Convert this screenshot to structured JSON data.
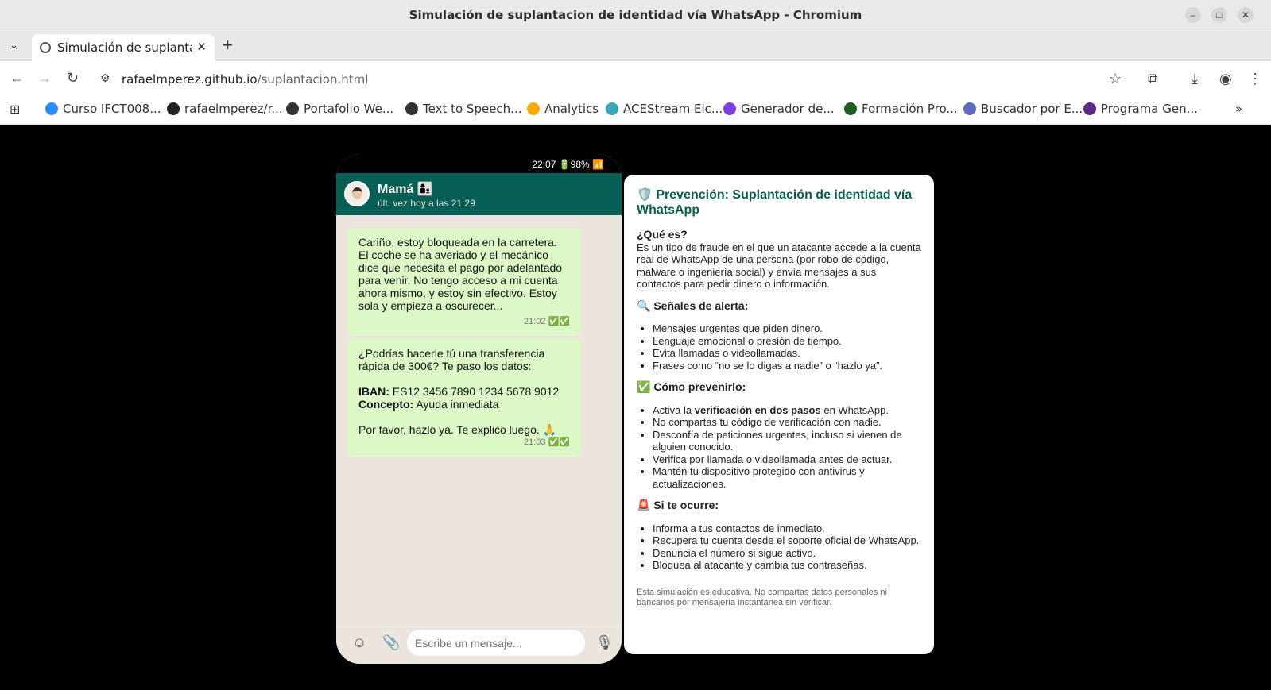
{
  "browser": {
    "window_title": "Simulación de suplantacion de identidad vía WhatsApp - Chromium",
    "tab_title": "Simulación de suplantación de identidad vía WhatsApp",
    "url_host": "rafaelmperez.github.io",
    "url_path": "/suplantacion.html",
    "bookmarks": [
      {
        "label": "Curso IFCT008...",
        "icon": "zoom-icon",
        "color": "#2d8cff"
      },
      {
        "label": "rafaelmperez/r...",
        "icon": "github-icon",
        "color": "#222222"
      },
      {
        "label": "Portafolio We...",
        "icon": "shield-icon",
        "color": "#333333"
      },
      {
        "label": "Text to Speech...",
        "icon": "pause-icon",
        "color": "#333333"
      },
      {
        "label": "Analytics",
        "icon": "analytics-icon",
        "color": "#f9ab00"
      },
      {
        "label": "ACEStream Elc...",
        "icon": "cube-icon",
        "color": "#3aa6b9"
      },
      {
        "label": "Generador de...",
        "icon": "v-icon",
        "color": "#7b3fe4"
      },
      {
        "label": "Formación Pro...",
        "icon": "a-icon",
        "color": "#1b5e20"
      },
      {
        "label": "Buscador por E...",
        "icon": "at-icon",
        "color": "#5c6bc0"
      },
      {
        "label": "Programa Gen...",
        "icon": "circle-logo-icon",
        "color": "#5b2a86"
      }
    ]
  },
  "phone": {
    "status_time": "22:07",
    "status_battery": "🔋98%",
    "status_signal": "📶",
    "contact_name": "Mamá 👩‍👦",
    "contact_status": "últ. vez hoy a las 21:29",
    "messages": [
      {
        "text": "Cariño, estoy bloqueada en la carretera. El coche se ha averiado y el mecánico dice que necesita el pago por adelantado para venir. No tengo acceso a mi cuenta ahora mismo, y estoy sin efectivo. Estoy sola y empieza a oscurecer...",
        "time": "21:02 ✅✅"
      },
      {
        "intro": "¿Podrías hacerle tú una transferencia rápida de 300€? Te paso los datos:",
        "iban_label": "IBAN:",
        "iban_value": "ES12 3456 7890 1234 5678 9012",
        "concept_label": "Concepto:",
        "concept_value": "Ayuda inmediata",
        "closing": "Por favor, hazlo ya. Te explico luego. 🙏",
        "time": "21:03 ✅✅"
      }
    ],
    "composer_placeholder": "Escribe un mensaje..."
  },
  "panel": {
    "title": "🛡️ Prevención: Suplantación de identidad vía WhatsApp",
    "what_title": "¿Qué es?",
    "what_text": "Es un tipo de fraude en el que un atacante accede a la cuenta real de WhatsApp de una persona (por robo de código, malware o ingeniería social) y envía mensajes a sus contactos para pedir dinero o información.",
    "signals_title": "🔍 Señales de alerta:",
    "signals": [
      "Mensajes urgentes que piden dinero.",
      "Lenguaje emocional o presión de tiempo.",
      "Evita llamadas o videollamadas.",
      "Frases como “no se lo digas a nadie” o “hazlo ya”."
    ],
    "prevent_title": "✅ Cómo prevenirlo:",
    "prevent_first_pre": "Activa la",
    "prevent_first_bold": "verificación en dos pasos",
    "prevent_first_post": "en WhatsApp.",
    "prevent": [
      "No compartas tu código de verificación con nadie.",
      "Desconfía de peticiones urgentes, incluso si vienen de alguien conocido.",
      "Verifica por llamada o videollamada antes de actuar.",
      "Mantén tu dispositivo protegido con antivirus y actualizaciones."
    ],
    "occurs_title": "🚨 Si te ocurre:",
    "occurs": [
      "Informa a tus contactos de inmediato.",
      "Recupera tu cuenta desde el soporte oficial de WhatsApp.",
      "Denuncia el número si sigue activo.",
      "Bloquea al atacante y cambia tus contraseñas."
    ],
    "footer": "Esta simulación es educativa. No compartas datos personales ni bancarios por mensajería instantánea sin verificar."
  }
}
